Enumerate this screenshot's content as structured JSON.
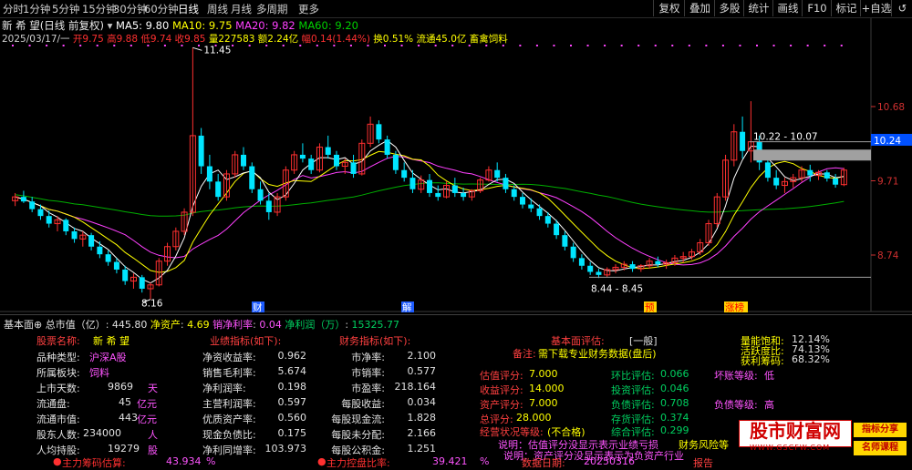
{
  "toolbar": {
    "periods": [
      "分时",
      "1分钟",
      "5分钟",
      "15分钟",
      "30分钟",
      "60分钟",
      "日线",
      "周线",
      "月线",
      "多周期",
      "更多"
    ],
    "active_period": "日线",
    "buttons": [
      "复权",
      "叠加",
      "多股",
      "统计",
      "画线",
      "F10",
      "标记",
      "+自选",
      "↺"
    ]
  },
  "header": {
    "line1_stock": "新 希 望(日线 前复权)",
    "ma5": "MA5: 9.80",
    "ma10": "MA10: 9.75",
    "ma20": "MA20: 9.82",
    "ma60": "MA60: 9.20",
    "line2_date": "2025/03/17/一",
    "open": "开9.75",
    "high": "高9.88",
    "low": "低9.74",
    "close": "收9.85",
    "volume": "量227583",
    "amount": "额2.24亿",
    "amplitude": "幅0.14(1.44%)",
    "turnover": "换0.51%",
    "float_cap": "流通45.0亿",
    "industry": "畜禽饲料"
  },
  "chart_data": {
    "type": "candlestick",
    "y_axis_labels": [
      "10.68",
      "9.71",
      "8.74"
    ],
    "current_price_tag": "10.24",
    "annotations": {
      "high_label": "11.45",
      "low_label": "8.16",
      "range_label_right": "10.22 - 10.07",
      "range_label_bottom": "8.44 - 8.45"
    },
    "event_markers": [
      "财",
      "解",
      "预",
      "涨榜"
    ],
    "series": [
      {
        "name": "MA5",
        "color": "#ffffff"
      },
      {
        "name": "MA10",
        "color": "#ffff00"
      },
      {
        "name": "MA20",
        "color": "#ff40ff"
      },
      {
        "name": "MA60",
        "color": "#00c000"
      }
    ],
    "candles": [
      [
        9.45,
        9.55,
        9.38,
        9.5
      ],
      [
        9.5,
        9.58,
        9.42,
        9.44
      ],
      [
        9.44,
        9.5,
        9.3,
        9.34
      ],
      [
        9.34,
        9.4,
        9.2,
        9.25
      ],
      [
        9.25,
        9.32,
        9.1,
        9.15
      ],
      [
        9.15,
        9.25,
        9.05,
        9.2
      ],
      [
        9.2,
        9.22,
        9.0,
        9.05
      ],
      [
        9.05,
        9.1,
        8.9,
        8.95
      ],
      [
        8.95,
        9.05,
        8.85,
        9.0
      ],
      [
        9.0,
        9.03,
        8.8,
        8.85
      ],
      [
        8.85,
        8.92,
        8.7,
        8.75
      ],
      [
        8.75,
        8.8,
        8.6,
        8.65
      ],
      [
        8.65,
        8.7,
        8.5,
        8.55
      ],
      [
        8.55,
        8.6,
        8.35,
        8.4
      ],
      [
        8.4,
        8.5,
        8.3,
        8.45
      ],
      [
        8.45,
        8.48,
        8.25,
        8.3
      ],
      [
        8.3,
        8.38,
        8.16,
        8.35
      ],
      [
        8.35,
        8.7,
        8.33,
        8.66
      ],
      [
        8.66,
        8.9,
        8.6,
        8.85
      ],
      [
        8.85,
        9.1,
        8.8,
        9.05
      ],
      [
        9.05,
        9.35,
        9.0,
        9.3
      ],
      [
        9.3,
        11.45,
        9.25,
        10.3
      ],
      [
        10.3,
        10.4,
        9.8,
        9.9
      ],
      [
        9.9,
        10.05,
        9.6,
        9.7
      ],
      [
        9.7,
        9.8,
        9.45,
        9.5
      ],
      [
        9.5,
        9.85,
        9.45,
        9.8
      ],
      [
        9.8,
        10.1,
        9.75,
        10.05
      ],
      [
        10.05,
        10.15,
        9.85,
        9.9
      ],
      [
        9.9,
        9.95,
        9.55,
        9.6
      ],
      [
        9.6,
        9.7,
        9.4,
        9.45
      ],
      [
        9.45,
        9.55,
        9.2,
        9.3
      ],
      [
        9.3,
        9.55,
        9.25,
        9.5
      ],
      [
        9.5,
        9.9,
        9.45,
        9.85
      ],
      [
        9.85,
        10.1,
        9.8,
        10.05
      ],
      [
        10.05,
        10.2,
        9.95,
        10.0
      ],
      [
        10.0,
        10.05,
        9.8,
        9.85
      ],
      [
        9.85,
        10.2,
        9.82,
        10.15
      ],
      [
        10.15,
        10.3,
        10.0,
        10.05
      ],
      [
        10.05,
        10.1,
        9.85,
        9.9
      ],
      [
        9.9,
        10.0,
        9.8,
        9.95
      ],
      [
        9.95,
        10.05,
        9.75,
        9.8
      ],
      [
        9.8,
        10.25,
        9.78,
        10.2
      ],
      [
        10.2,
        10.55,
        10.15,
        10.45
      ],
      [
        10.45,
        10.5,
        10.2,
        10.25
      ],
      [
        10.25,
        10.3,
        10.0,
        10.05
      ],
      [
        10.05,
        10.1,
        9.8,
        9.85
      ],
      [
        9.85,
        9.95,
        9.7,
        9.75
      ],
      [
        9.75,
        9.85,
        9.55,
        9.6
      ],
      [
        9.6,
        9.78,
        9.55,
        9.72
      ],
      [
        9.72,
        9.8,
        9.5,
        9.55
      ],
      [
        9.55,
        9.65,
        9.45,
        9.5
      ],
      [
        9.5,
        9.7,
        9.48,
        9.65
      ],
      [
        9.65,
        9.75,
        9.5,
        9.55
      ],
      [
        9.55,
        9.62,
        9.45,
        9.5
      ],
      [
        9.5,
        9.6,
        9.45,
        9.58
      ],
      [
        9.58,
        9.75,
        9.55,
        9.72
      ],
      [
        9.72,
        9.9,
        9.7,
        9.85
      ],
      [
        9.85,
        9.95,
        9.7,
        9.75
      ],
      [
        9.75,
        9.8,
        9.55,
        9.6
      ],
      [
        9.6,
        9.65,
        9.45,
        9.5
      ],
      [
        9.5,
        9.55,
        9.35,
        9.4
      ],
      [
        9.4,
        9.48,
        9.3,
        9.35
      ],
      [
        9.35,
        9.4,
        9.2,
        9.25
      ],
      [
        9.25,
        9.3,
        9.1,
        9.15
      ],
      [
        9.15,
        9.2,
        8.95,
        9.0
      ],
      [
        9.0,
        9.05,
        8.8,
        8.85
      ],
      [
        8.85,
        8.9,
        8.65,
        8.7
      ],
      [
        8.7,
        8.75,
        8.55,
        8.6
      ],
      [
        8.6,
        8.65,
        8.48,
        8.52
      ],
      [
        8.52,
        8.56,
        8.44,
        8.48
      ],
      [
        8.48,
        8.58,
        8.45,
        8.55
      ],
      [
        8.55,
        8.62,
        8.5,
        8.58
      ],
      [
        8.58,
        8.66,
        8.54,
        8.62
      ],
      [
        8.62,
        8.66,
        8.52,
        8.56
      ],
      [
        8.56,
        8.62,
        8.52,
        8.6
      ],
      [
        8.6,
        8.7,
        8.56,
        8.66
      ],
      [
        8.66,
        8.72,
        8.58,
        8.62
      ],
      [
        8.62,
        8.68,
        8.56,
        8.64
      ],
      [
        8.64,
        8.74,
        8.6,
        8.7
      ],
      [
        8.7,
        8.78,
        8.64,
        8.72
      ],
      [
        8.72,
        8.82,
        8.68,
        8.78
      ],
      [
        8.78,
        8.95,
        8.74,
        8.9
      ],
      [
        8.9,
        9.2,
        8.86,
        9.15
      ],
      [
        9.15,
        9.55,
        9.1,
        9.5
      ],
      [
        9.5,
        10.05,
        9.45,
        9.98
      ],
      [
        9.98,
        10.45,
        9.9,
        10.35
      ],
      [
        10.35,
        10.55,
        10.0,
        10.1
      ],
      [
        10.1,
        10.75,
        9.95,
        10.22
      ],
      [
        10.22,
        10.3,
        9.85,
        9.95
      ],
      [
        9.95,
        10.0,
        9.7,
        9.75
      ],
      [
        9.75,
        9.85,
        9.6,
        9.65
      ],
      [
        9.65,
        9.75,
        9.55,
        9.7
      ],
      [
        9.7,
        9.8,
        9.62,
        9.75
      ],
      [
        9.75,
        9.9,
        9.7,
        9.85
      ],
      [
        9.85,
        9.92,
        9.7,
        9.78
      ],
      [
        9.78,
        9.85,
        9.72,
        9.82
      ],
      [
        9.82,
        9.85,
        9.7,
        9.74
      ],
      [
        9.74,
        9.8,
        9.62,
        9.66
      ],
      [
        9.66,
        9.88,
        9.64,
        9.85
      ]
    ]
  },
  "panel": {
    "title": "基本面⊕",
    "total_mv_label": "总市值（亿）",
    "total_mv": "445.80",
    "net_assets_label": "净资产",
    "net_assets": "4.69",
    "net_margin_label": "销净利率",
    "net_margin": "0.04",
    "net_profit_label": "净利润（万）",
    "net_profit": "15325.77",
    "basic": {
      "name_label": "股票名称:",
      "name_value": "新 希 望",
      "rows": [
        {
          "label": "品种类型:",
          "value": "沪深A股",
          "unit": ""
        },
        {
          "label": "所属板块:",
          "value": "饲料",
          "unit": ""
        },
        {
          "label": "上市天数:",
          "value": "9869",
          "unit": "天"
        },
        {
          "label": "流通盘:",
          "value": "45",
          "unit": "亿元"
        },
        {
          "label": "流通市值:",
          "value": "443",
          "unit": "亿元"
        },
        {
          "label": "股东人数:",
          "value": "234000",
          "unit": "人"
        },
        {
          "label": "人均持股:",
          "value": "19279",
          "unit": "股"
        }
      ]
    },
    "performance": {
      "title": "业绩指标(如下):",
      "rows": [
        {
          "label": "净资收益率:",
          "value": "0.962"
        },
        {
          "label": "销售毛利率:",
          "value": "5.674"
        },
        {
          "label": "净利润率:",
          "value": "0.198"
        },
        {
          "label": "主营利润率:",
          "value": "0.597"
        },
        {
          "label": "优质资产率:",
          "value": "0.560"
        },
        {
          "label": "现金负债比:",
          "value": "0.175"
        },
        {
          "label": "净利同增率:",
          "value": "103.973"
        }
      ]
    },
    "financial": {
      "title": "财务指标(如下):",
      "rows": [
        {
          "label": "市净率:",
          "value": "2.100"
        },
        {
          "label": "市销率:",
          "value": "0.577"
        },
        {
          "label": "市盈率:",
          "value": "218.164"
        },
        {
          "label": "每股收益:",
          "value": "0.034"
        },
        {
          "label": "每股现金流:",
          "value": "1.828"
        },
        {
          "label": "每股未分配:",
          "value": "2.166"
        },
        {
          "label": "每股公积金:",
          "value": "1.251"
        }
      ]
    },
    "evaluation": {
      "title": "基本面评估:",
      "title_value": "[一般]",
      "note_label": "备注:",
      "note": "需下载专业财务数据(盘后)",
      "left": [
        {
          "label": "估值评分:",
          "value": "7.000"
        },
        {
          "label": "收益评分:",
          "value": "14.000"
        },
        {
          "label": "资产评分:",
          "value": "7.000"
        },
        {
          "label": "总评分:",
          "value": "28.000"
        },
        {
          "label": "经营状况等级:",
          "value": "(不合格)"
        }
      ],
      "mid": [
        {
          "label": "环比评估:",
          "value": "0.066"
        },
        {
          "label": "投资评估:",
          "value": "0.046"
        },
        {
          "label": "负债评估:",
          "value": "0.708"
        },
        {
          "label": "存货评估:",
          "value": "0.374"
        },
        {
          "label": "综合评估:",
          "value": "0.299"
        }
      ],
      "right": [
        {
          "label": "坏账等级:",
          "value": "低"
        },
        {
          "label": "负债等级:",
          "value": "高"
        }
      ],
      "line1": "说明：估值评分没显示表示业绩亏损",
      "line2": "说明：资产评分没显示表示为负资产行业",
      "risk": "财务风险等",
      "date_label": "数据日期:",
      "date_value": "20250316",
      "report": "报告"
    },
    "chip": {
      "rows": [
        {
          "label": "量能饱和:",
          "value": "12.14%"
        },
        {
          "label": "活跃度比:",
          "value": "74.13%"
        },
        {
          "label": "获利筹码:",
          "value": "68.32%"
        }
      ]
    },
    "bottom": [
      {
        "label": "主力筹码估算:",
        "value": "43.934",
        "unit": "%"
      },
      {
        "label": "主力控盘比率:",
        "value": "39.421",
        "unit": "%"
      }
    ]
  },
  "watermark": {
    "title": "股市财富网",
    "url": "WWW.GSCFW.COM",
    "tag1": "指标分享",
    "tag2": "名师课程"
  }
}
